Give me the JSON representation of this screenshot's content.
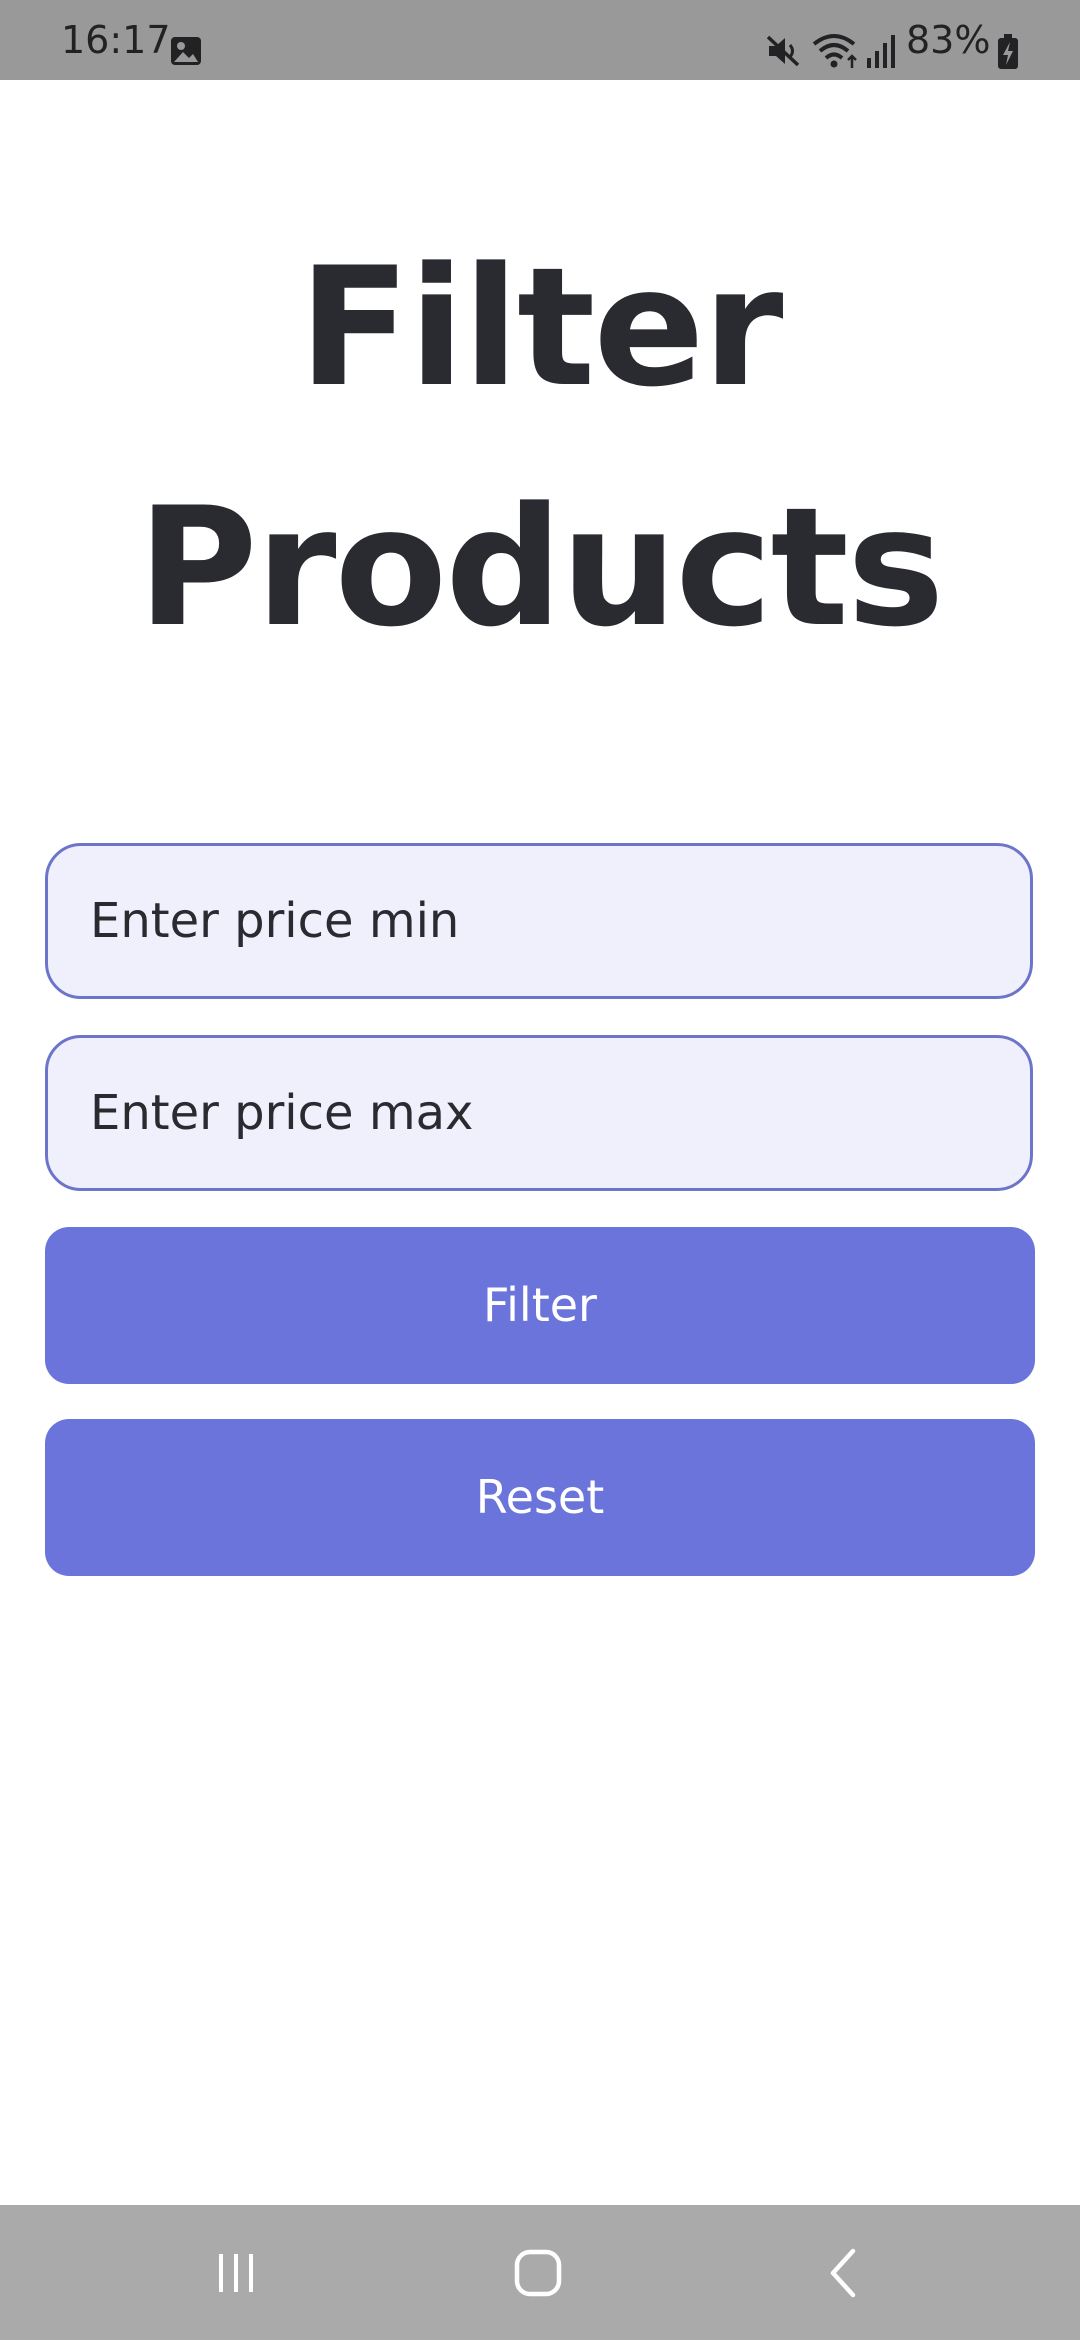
{
  "status_bar": {
    "time": "16:17",
    "battery_percent": "83%",
    "icons": [
      "gallery-icon",
      "mute-icon",
      "wifi-icon",
      "signal-icon",
      "battery-charging-icon"
    ]
  },
  "page": {
    "title": "Filter Products"
  },
  "form": {
    "price_min_placeholder": "Enter price min",
    "price_max_placeholder": "Enter price max",
    "filter_label": "Filter",
    "reset_label": "Reset"
  },
  "nav_bar": {
    "icons": [
      "recents-icon",
      "home-icon",
      "back-icon"
    ]
  },
  "colors": {
    "accent": "#6b74da",
    "input_background": "#f0f0fc",
    "input_border": "#6c75c9",
    "text_dark": "#2a2a31",
    "status_bar_bg": "#999999",
    "nav_bar_bg": "#aaaaaa"
  }
}
